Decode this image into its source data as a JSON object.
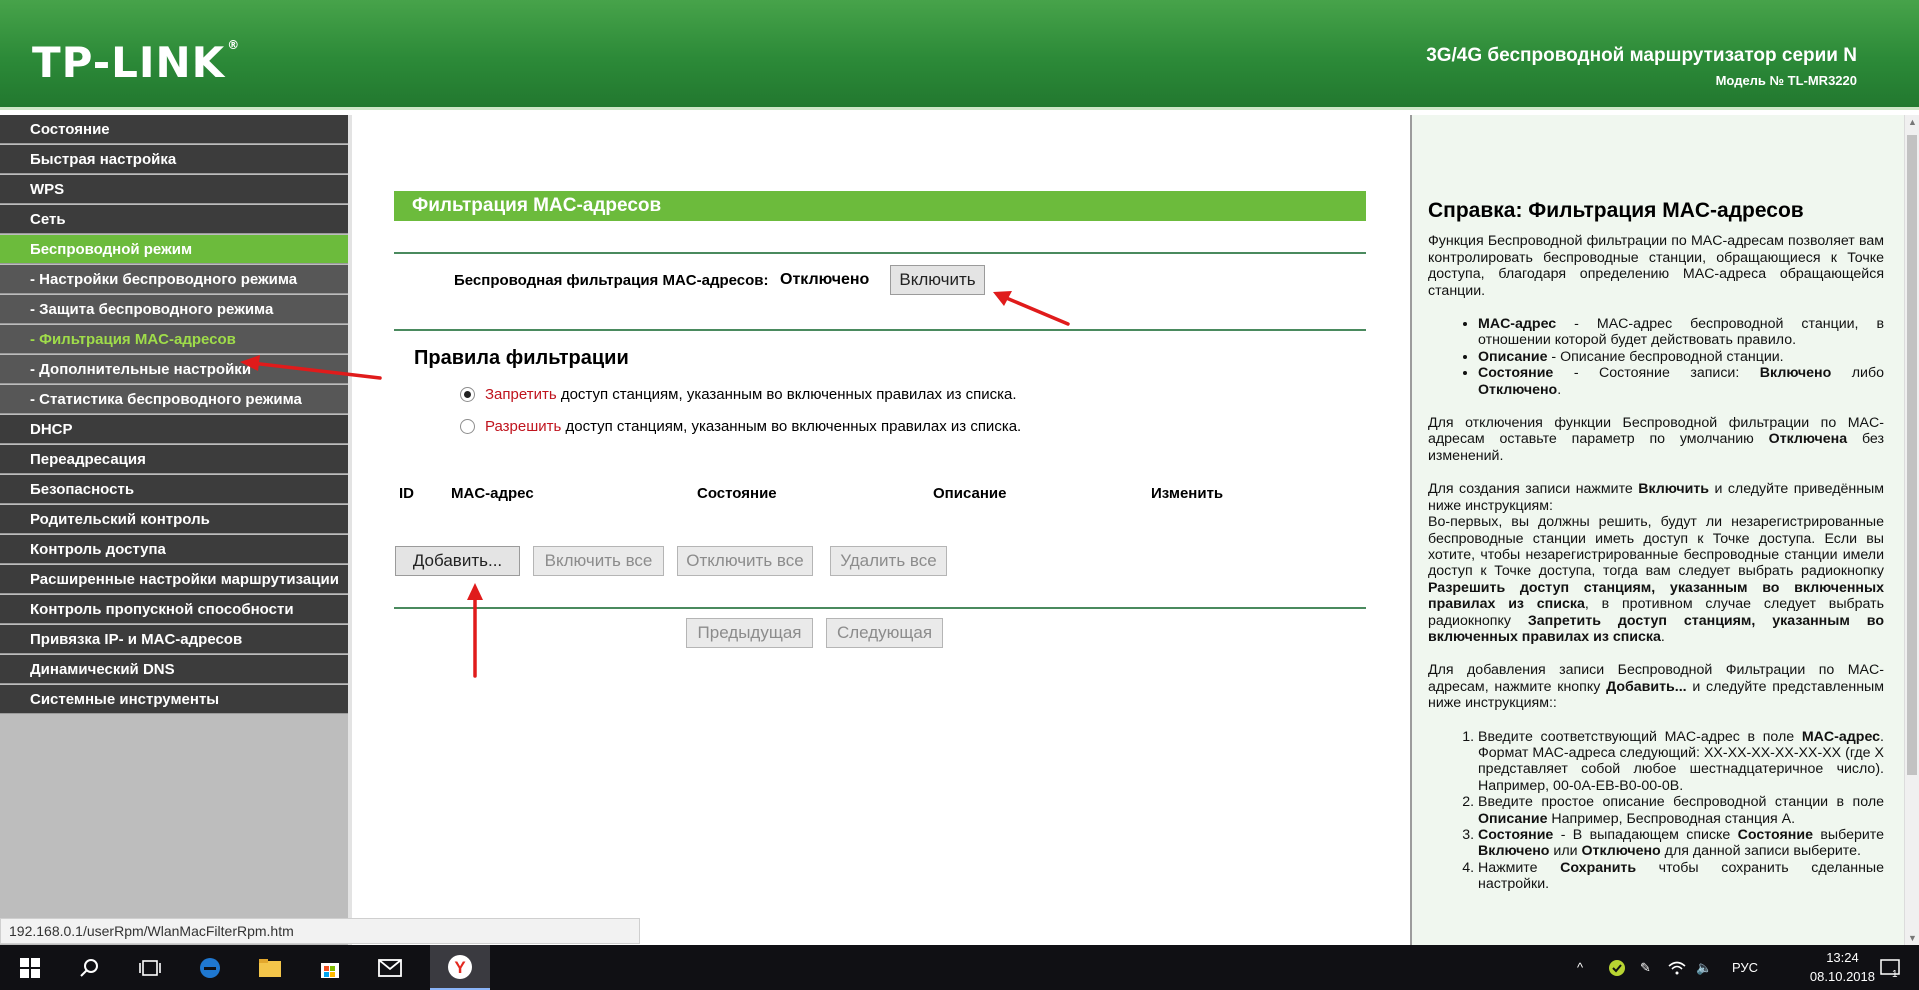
{
  "header": {
    "logo": "TP-LINK",
    "logo_mark": "®",
    "title": "3G/4G беспроводной маршрутизатор серии N",
    "model": "Модель № TL-MR3220"
  },
  "menu": {
    "items": [
      {
        "label": "Состояние"
      },
      {
        "label": "Быстрая настройка"
      },
      {
        "label": "WPS"
      },
      {
        "label": "Сеть"
      },
      {
        "label": "Беспроводной режим"
      },
      {
        "label": "- Настройки беспроводного режима"
      },
      {
        "label": "- Защита беспроводного режима"
      },
      {
        "label": "- Фильтрация MAC-адресов"
      },
      {
        "label": "- Дополнительные настройки"
      },
      {
        "label": "- Статистика беспроводного режима"
      },
      {
        "label": "DHCP"
      },
      {
        "label": "Переадресация"
      },
      {
        "label": "Безопасность"
      },
      {
        "label": "Родительский контроль"
      },
      {
        "label": "Контроль доступа"
      },
      {
        "label": "Расширенные настройки маршрутизации"
      },
      {
        "label": "Контроль пропускной способности"
      },
      {
        "label": "Привязка IP- и MAC-адресов"
      },
      {
        "label": "Динамический DNS"
      },
      {
        "label": "Системные инструменты"
      }
    ]
  },
  "main": {
    "section_title": "Фильтрация MAC-адресов",
    "filter_label": "Беспроводная фильтрация MAC-адресов:",
    "filter_status": "Отключено",
    "enable_button": "Включить",
    "rules_title": "Правила фильтрации",
    "rule_deny_word": "Запретить",
    "rule_deny_rest": " доступ станциям, указанным во включенных правилах из списка.",
    "rule_allow_word": "Разрешить",
    "rule_allow_rest": " доступ станциям, указанным во включенных правилах из списка.",
    "rule_selected": "deny",
    "table_headers": [
      "ID",
      "MAC-адрес",
      "Состояние",
      "Описание",
      "Изменить"
    ],
    "add_button": "Добавить...",
    "enable_all_button": "Включить все",
    "disable_all_button": "Отключить все",
    "delete_all_button": "Удалить все",
    "prev_button": "Предыдущая",
    "next_button": "Следующая"
  },
  "help": {
    "title": "Справка: Фильтрация MAC-адресов",
    "intro": "Функция Беспроводной фильтрации по MAC-адресам позволяет вам контролировать беспроводные станции, обращающиеся к Точке доступа, благодаря определению MAC-адреса обращающейся станции.",
    "fields": [
      {
        "name": "MAC-адрес",
        "text": " - MAC-адрес беспроводной станции, в отношении которой будет действовать правило."
      },
      {
        "name": "Описание",
        "text": " - Описание беспроводной станции."
      },
      {
        "name": "Состояние",
        "text": " - Состояние записи: ",
        "b1": "Включено",
        "mid": " либо ",
        "b2": "Отключено",
        "end": "."
      }
    ],
    "disable": {
      "pre": "Для отключения функции Беспроводной фильтрации по MAC-адресам оставьте параметр по умолчанию ",
      "bold": "Отключена",
      "post": " без изменений."
    },
    "create": {
      "p1": "Для создания записи нажмите ",
      "b1": "Включить",
      "p2": " и следуйте приведённым ниже инструкциям:",
      "p3": "Во-первых, вы должны решить, будут ли незарегистрированные беспроводные станции иметь доступ к Точке доступа. Если вы хотите, чтобы незарегистрированные беспроводные станции имели доступ к Точке доступа, тогда вам следует выбрать радиокнопку ",
      "b2": "Разрешить доступ станциям, указанным во включенных правилах из списка",
      "p4": ", в противном случае следует выбрать радиокнопку ",
      "b3": "Запретить доступ станциям, указанным во включенных правилах из списка",
      "p5": "."
    },
    "add": {
      "pre": "Для добавления записи Беспроводной Фильтрации по MAC-адресам, нажмите кнопку ",
      "bold": "Добавить...",
      "post": " и следуйте представленным ниже инструкциям::"
    },
    "steps": [
      {
        "pre": "Введите соответствующий MAC-адрес в поле ",
        "bold": "MAC-адрес",
        "post": ". Формат MAC-адреса следующий: XX-XX-XX-XX-XX-XX (где X представляет собой любое шестнадцатеричное число). Например, 00-0A-EB-B0-00-0B."
      },
      {
        "pre": "Введите простое описание беспроводной станции в поле ",
        "bold": "Описание",
        "post": " Например, Беспроводная станция A."
      },
      {
        "bold0": "Состояние",
        "pre": " - В выпадающем списке ",
        "bold": "Состояние",
        "mid": " выберите ",
        "bold2": "Включено",
        "mid2": " или ",
        "bold3": "Отключено",
        "post": " для данной записи выберите."
      },
      {
        "pre": "Нажмите ",
        "bold": "Сохранить",
        "post": " чтобы сохранить сделанные настройки."
      }
    ]
  },
  "status_url": "192.168.0.1/userRpm/WlanMacFilterRpm.htm",
  "taskbar": {
    "icons": [
      "windows-start-icon",
      "search-icon",
      "task-view-icon",
      "edge-browser-icon",
      "file-explorer-icon",
      "store-icon",
      "mail-icon",
      "yandex-browser-icon"
    ],
    "language": "РУС",
    "time": "13:24",
    "date": "08.10.2018",
    "notification_count": "1"
  },
  "colors": {
    "header_green": "#2c8a38",
    "accent_green": "#6cbb3c",
    "menu_dark": "#3c3c3c",
    "menu_sub": "#575757",
    "current_item": "#9fdc4a",
    "red_text": "#c0141e",
    "arrow_red": "#e01b1b"
  }
}
